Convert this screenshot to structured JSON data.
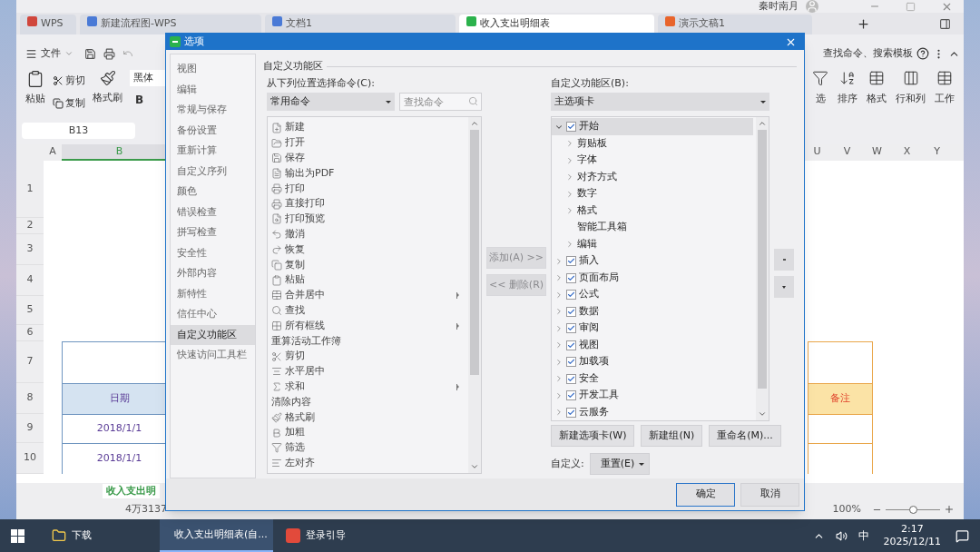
{
  "app": {
    "user": "秦时南月",
    "tabs": [
      {
        "label": "WPS",
        "selected": false
      },
      {
        "label": "新建流程图-WPS",
        "selected": false
      },
      {
        "label": "文档1",
        "selected": false
      },
      {
        "label": "收入支出明细表",
        "selected": true
      },
      {
        "label": "演示文稿1",
        "selected": false
      }
    ],
    "menu": {
      "file": "文件",
      "search": "查找命令、搜索模板"
    },
    "tools_left": {
      "paste": "粘贴",
      "cut": "剪切",
      "copy": "复制",
      "painter": "格式刷",
      "font": "黑体",
      "bold": "B"
    },
    "tools_right": [
      "选",
      "排序",
      "格式",
      "行和列",
      "工作"
    ],
    "name_box": "B13",
    "columns_left": [
      "A",
      "B"
    ],
    "columns_right": [
      "U",
      "V",
      "W",
      "X",
      "Y"
    ],
    "rows": [
      {
        "number": "1",
        "kind": "blank"
      },
      {
        "number": "2",
        "kind": "blank"
      },
      {
        "number": "3",
        "kind": "blank"
      },
      {
        "number": "4",
        "kind": "blank"
      },
      {
        "number": "5",
        "kind": "blank"
      },
      {
        "number": "6",
        "kind": "blank"
      },
      {
        "number": "7",
        "kind": "title"
      },
      {
        "number": "8",
        "kind": "header",
        "left": "日期",
        "right": "备注"
      },
      {
        "number": "9",
        "kind": "data",
        "left": "2018/1/1"
      },
      {
        "number": "10",
        "kind": "data",
        "left": "2018/1/1"
      }
    ],
    "sheet_tab": "收入支出明",
    "status": "4万3137",
    "zoom": {
      "label": "100%",
      "level": 0.5
    }
  },
  "dialog": {
    "title": "选项",
    "nav": [
      {
        "label": "视图",
        "selected": false
      },
      {
        "label": "编辑",
        "selected": false
      },
      {
        "label": "常规与保存",
        "selected": false
      },
      {
        "label": "备份设置",
        "selected": false
      },
      {
        "label": "重新计算",
        "selected": false
      },
      {
        "label": "自定义序列",
        "selected": false
      },
      {
        "label": "颜色",
        "selected": false
      },
      {
        "label": "错误检查",
        "selected": false
      },
      {
        "label": "拼写检查",
        "selected": false
      },
      {
        "label": "安全性",
        "selected": false
      },
      {
        "label": "外部内容",
        "selected": false
      },
      {
        "label": "新特性",
        "selected": false
      },
      {
        "label": "信任中心",
        "selected": false
      },
      {
        "label": "自定义功能区",
        "selected": true
      },
      {
        "label": "快速访问工具栏",
        "selected": false
      }
    ],
    "section": "自定义功能区",
    "source_label": "从下列位置选择命令(C):",
    "source_value": "常用命令",
    "search_placeholder": "查找命令",
    "commands": [
      {
        "label": "新建",
        "kind": "command",
        "submenu": false
      },
      {
        "label": "打开",
        "kind": "command",
        "submenu": false
      },
      {
        "label": "保存",
        "kind": "command",
        "submenu": false
      },
      {
        "label": "输出为PDF",
        "kind": "command",
        "submenu": false
      },
      {
        "label": "打印",
        "kind": "command",
        "submenu": false
      },
      {
        "label": "直接打印",
        "kind": "command",
        "submenu": false
      },
      {
        "label": "打印预览",
        "kind": "command",
        "submenu": false
      },
      {
        "label": "撤消",
        "kind": "command",
        "submenu": false
      },
      {
        "label": "恢复",
        "kind": "command",
        "submenu": false
      },
      {
        "label": "复制",
        "kind": "command",
        "submenu": false
      },
      {
        "label": "粘贴",
        "kind": "command",
        "submenu": false
      },
      {
        "label": "合并居中",
        "kind": "command",
        "submenu": true
      },
      {
        "label": "查找",
        "kind": "command",
        "submenu": false
      },
      {
        "label": "所有框线",
        "kind": "command",
        "submenu": true
      },
      {
        "label": "重算活动工作簿",
        "kind": "plain",
        "submenu": false
      },
      {
        "label": "剪切",
        "kind": "command",
        "submenu": false
      },
      {
        "label": "水平居中",
        "kind": "command",
        "submenu": false
      },
      {
        "label": "求和",
        "kind": "command",
        "submenu": true
      },
      {
        "label": "清除内容",
        "kind": "plain",
        "submenu": false
      },
      {
        "label": "格式刷",
        "kind": "command",
        "submenu": false
      },
      {
        "label": "加粗",
        "kind": "command",
        "submenu": false
      },
      {
        "label": "筛选",
        "kind": "command",
        "submenu": false
      },
      {
        "label": "左对齐",
        "kind": "command",
        "submenu": false
      }
    ],
    "add_button": {
      "label": "添加(A) >>",
      "disabled": true
    },
    "remove_button": {
      "label": "<< 删除(R)",
      "disabled": true
    },
    "target_label": "自定义功能区(B):",
    "target_value": "主选项卡",
    "tree": [
      {
        "label": "开始",
        "checked": true,
        "expanded": true,
        "selected": true,
        "children": [
          {
            "label": "剪贴板",
            "expandable": true,
            "selected": false
          },
          {
            "label": "字体",
            "expandable": true,
            "selected": false
          },
          {
            "label": "对齐方式",
            "expandable": true,
            "selected": false
          },
          {
            "label": "数字",
            "expandable": true,
            "selected": false
          },
          {
            "label": "格式",
            "expandable": true,
            "selected": false
          },
          {
            "label": "智能工具箱",
            "expandable": false,
            "selected": false
          },
          {
            "label": "编辑",
            "expandable": true,
            "selected": false
          }
        ]
      },
      {
        "label": "插入",
        "checked": true,
        "expanded": false,
        "selected": false
      },
      {
        "label": "页面布局",
        "checked": true,
        "expanded": false,
        "selected": false
      },
      {
        "label": "公式",
        "checked": true,
        "expanded": false,
        "selected": false
      },
      {
        "label": "数据",
        "checked": true,
        "expanded": false,
        "selected": false
      },
      {
        "label": "审阅",
        "checked": true,
        "expanded": false,
        "selected": false
      },
      {
        "label": "视图",
        "checked": true,
        "expanded": false,
        "selected": false
      },
      {
        "label": "加载项",
        "checked": true,
        "expanded": false,
        "selected": false
      },
      {
        "label": "安全",
        "checked": true,
        "expanded": false,
        "selected": false
      },
      {
        "label": "开发工具",
        "checked": true,
        "expanded": false,
        "selected": false
      },
      {
        "label": "云服务",
        "checked": true,
        "expanded": false,
        "selected": false
      }
    ],
    "tree_buttons": [
      "新建选项卡(W)",
      "新建组(N)",
      "重命名(M)..."
    ],
    "customize_label": "自定义:",
    "reset_button": "重置(E)",
    "ok": "确定",
    "cancel": "取消"
  },
  "taskbar": {
    "items": [
      {
        "label": "下载",
        "selected": false
      },
      {
        "label": "收入支出明细表(自...",
        "selected": true
      },
      {
        "label": "登录引导",
        "selected": false
      }
    ],
    "ime": "中",
    "time": "2:17",
    "date": "2025/12/11"
  }
}
